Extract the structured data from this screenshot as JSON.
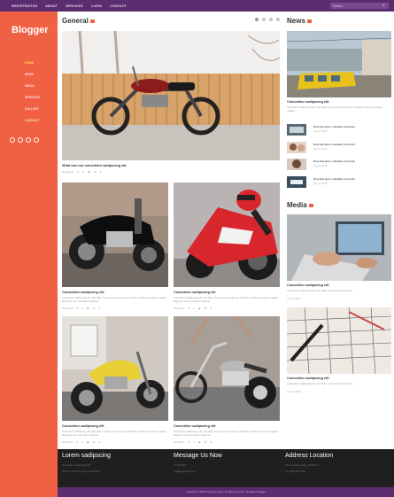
{
  "topnav": [
    "REGISTRATION",
    "ABOUT",
    "SERVICES",
    "LOGIN",
    "CONTACT"
  ],
  "search_placeholder": "Search",
  "logo": "Blogger",
  "menu": [
    "HOME",
    "NEWS",
    "MEDIA",
    "SERVICES",
    "GALLERY",
    "CONTACT"
  ],
  "general": {
    "title": "General",
    "featured": {
      "title": "What turn out consetetur sadipscing elit",
      "date": "On Aug 27",
      "comments": "0",
      "views": "36"
    },
    "cards": [
      {
        "title": "Consetetur sadipscing elit",
        "text": "Consetetur sadipscing elit, sed diam nonumy eirmod tempor invidunt ut labore et dolore magna aliquyam erat, sed diam voluptua.",
        "date": "On Jul 27",
        "comments": "0",
        "views": "36"
      },
      {
        "title": "Consetetur sadipscing elit",
        "text": "Consetetur sadipscing elit, sed diam nonumy eirmod tempor invidunt ut labore et dolore magna aliquyam erat, sed diam voluptua.",
        "date": "On Jul 27",
        "comments": "0",
        "views": "36"
      },
      {
        "title": "Consetetur sadipscing elit",
        "text": "Consetetur sadipscing elit, sed diam nonumy eirmod tempor invidunt ut labore et dolore magna aliquyam erat, sed diam voluptua.",
        "date": "On Jul 27",
        "comments": "0",
        "views": "36"
      },
      {
        "title": "Consetetur sadipscing elit",
        "text": "Consetetur sadipscing elit, sed diam nonumy eirmod tempor invidunt ut labore et dolore magna aliquyam erat, sed diam voluptua.",
        "date": "On Jul 27",
        "comments": "0",
        "views": "36"
      }
    ]
  },
  "news": {
    "title": "News",
    "lead": {
      "title": "Consetetur sadipscing elit",
      "text": "Consetetur sadipscing elit, sed diam nonumy eirmod tempor invidunt ut labore et dolore magna."
    },
    "items": [
      {
        "title": "Now that app is simulate your lister",
        "date": "Aug 12, 2015"
      },
      {
        "title": "Now that app is simulate your lister",
        "date": "Aug 12, 2015"
      },
      {
        "title": "Now that app is simulate your lister",
        "date": "Aug 12, 2015"
      },
      {
        "title": "Now that app is simulate your lister",
        "date": "Aug 12, 2015"
      }
    ]
  },
  "media": {
    "title": "Media",
    "items": [
      {
        "title": "Consetetur sadipscing elit",
        "text": "Consetetur sadipscing elit, sed diam nonumy eirmod tempor.",
        "date": "Aug 12, 2015"
      },
      {
        "title": "Consetetur sadipscing elit",
        "text": "Consetetur sadipscing elit, sed diam nonumy eirmod tempor.",
        "date": "Aug 12, 2015"
      }
    ]
  },
  "footer": {
    "col1": {
      "title": "Lorem sadipscing",
      "lines": [
        "Consetetur sadipscing elit",
        "Sed do eiusmod tempor incididunt"
      ]
    },
    "col2": {
      "title": "Message Us Now",
      "lines": [
        "+1 234 567",
        "mail@example.com"
      ]
    },
    "col3": {
      "title": "Address Location",
      "lines": [
        "The company name, 89 4th St",
        "+1 (234) 567 8901"
      ]
    }
  },
  "copyright": "Copyright © 2015 Company name. All rights reserved. Template: Blogger",
  "colors": {
    "purple": "#5b2c6f",
    "coral": "#ef6142"
  }
}
